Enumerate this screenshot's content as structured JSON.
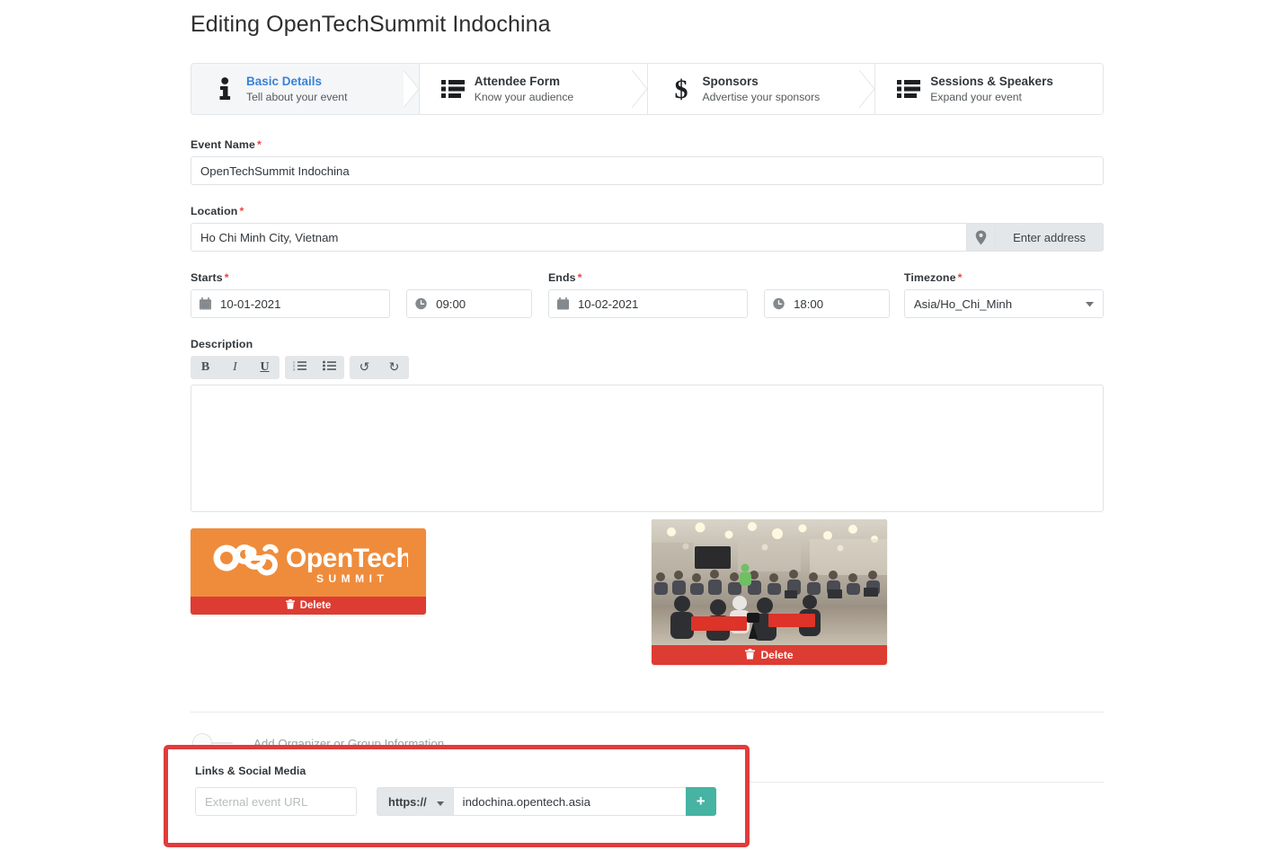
{
  "page": {
    "title": "Editing OpenTechSummit Indochina"
  },
  "wizard": {
    "tabs": [
      {
        "title": "Basic Details",
        "subtitle": "Tell about your event",
        "icon": "info-icon",
        "active": true
      },
      {
        "title": "Attendee Form",
        "subtitle": "Know your audience",
        "icon": "list-icon",
        "active": false
      },
      {
        "title": "Sponsors",
        "subtitle": "Advertise your sponsors",
        "icon": "dollar-icon",
        "active": false
      },
      {
        "title": "Sessions & Speakers",
        "subtitle": "Expand your event",
        "icon": "list-icon",
        "active": false
      }
    ]
  },
  "form": {
    "event_name": {
      "label": "Event Name",
      "required": "*",
      "value": "OpenTechSummit Indochina",
      "placeholder": ""
    },
    "location": {
      "label": "Location",
      "required": "*",
      "value": "Ho Chi Minh City, Vietnam",
      "placeholder": "",
      "button_label": "Enter address",
      "pin_icon": "map-pin-icon"
    },
    "starts": {
      "label": "Starts",
      "required": "*",
      "date": "10-01-2021",
      "time": "09:00"
    },
    "ends": {
      "label": "Ends",
      "required": "*",
      "date": "10-02-2021",
      "time": "18:00"
    },
    "timezone": {
      "label": "Timezone",
      "required": "*",
      "value": "Asia/Ho_Chi_Minh"
    },
    "description": {
      "label": "Description",
      "value": "",
      "toolbar": [
        {
          "name": "bold-button",
          "glyph": "B"
        },
        {
          "name": "italic-button",
          "glyph": "I"
        },
        {
          "name": "underline-button",
          "glyph": "U"
        },
        {
          "name": "ordered-list-button",
          "glyph": "ordered-list-icon"
        },
        {
          "name": "unordered-list-button",
          "glyph": "unordered-list-icon"
        },
        {
          "name": "undo-button",
          "glyph": "↺"
        },
        {
          "name": "redo-button",
          "glyph": "↻"
        }
      ]
    }
  },
  "media": {
    "logo": {
      "alt": "OpenTech Summit logo",
      "wordmark": "OpenTech",
      "tagline": "S U M M I T",
      "delete_label": "Delete"
    },
    "photo": {
      "alt": "Conference hall photo",
      "delete_label": "Delete"
    }
  },
  "organizer_toggle": {
    "label": "Add Organizer or Group Information",
    "state": "off"
  },
  "links": {
    "title": "Links & Social Media",
    "external_url_placeholder": "External event URL",
    "external_url_value": "",
    "protocol": "https://",
    "url_value": "indochina.opentech.asia",
    "add_label": "+"
  },
  "colors": {
    "accent_blue": "#3c82d6",
    "danger_red": "#dd3c32",
    "highlight_red": "#e03c3c",
    "teal": "#46b3a3",
    "logo_orange": "#ef8c3c",
    "required_red": "#e8453c"
  }
}
